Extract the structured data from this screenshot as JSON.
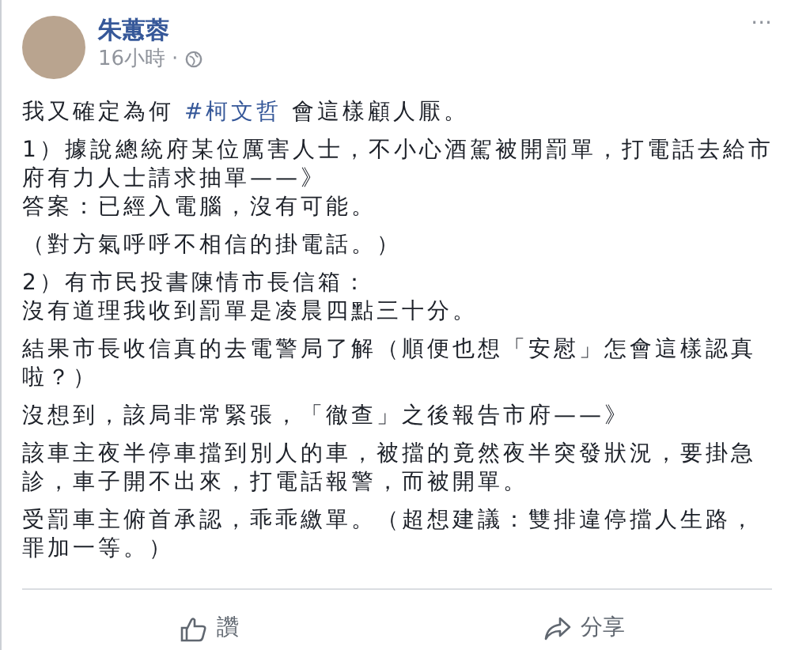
{
  "post": {
    "author": "朱蕙蓉",
    "time": "16小時",
    "separator": "·",
    "more": "···",
    "intro": {
      "before": "我又確定為何 ",
      "hashtag": "#柯文哲",
      "after": " 會這樣顧人厭。"
    },
    "paragraphs": [
      {
        "lines": [
          "1）據說總統府某位厲害人士，不小心酒駕被開罰單，打電話去給市府有力人士請求抽單——》",
          "答案：已經入電腦，沒有可能。"
        ]
      },
      {
        "lines": [
          "（對方氣呼呼不相信的掛電話。）"
        ]
      },
      {
        "lines": [
          "2）有市民投書陳情市長信箱：",
          "沒有道理我收到罰單是凌晨四點三十分。"
        ]
      },
      {
        "lines": [
          "結果市長收信真的去電警局了解（順便也想「安慰」怎會這樣認真啦？）"
        ]
      },
      {
        "lines": [
          "沒想到，該局非常緊張，「徹查」之後報告市府——》"
        ]
      },
      {
        "lines": [
          "該車主夜半停車擋到別人的車，被擋的竟然夜半突發狀況，要掛急診，車子開不出來，打電話報警，而被開單。"
        ]
      },
      {
        "lines": [
          "受罰車主俯首承認，乖乖繳單。（超想建議：雙排違停擋人生路，罪加一等。）"
        ]
      }
    ]
  },
  "actions": [
    {
      "kind": "like",
      "label": "讚"
    },
    {
      "kind": "share",
      "label": "分享"
    }
  ]
}
